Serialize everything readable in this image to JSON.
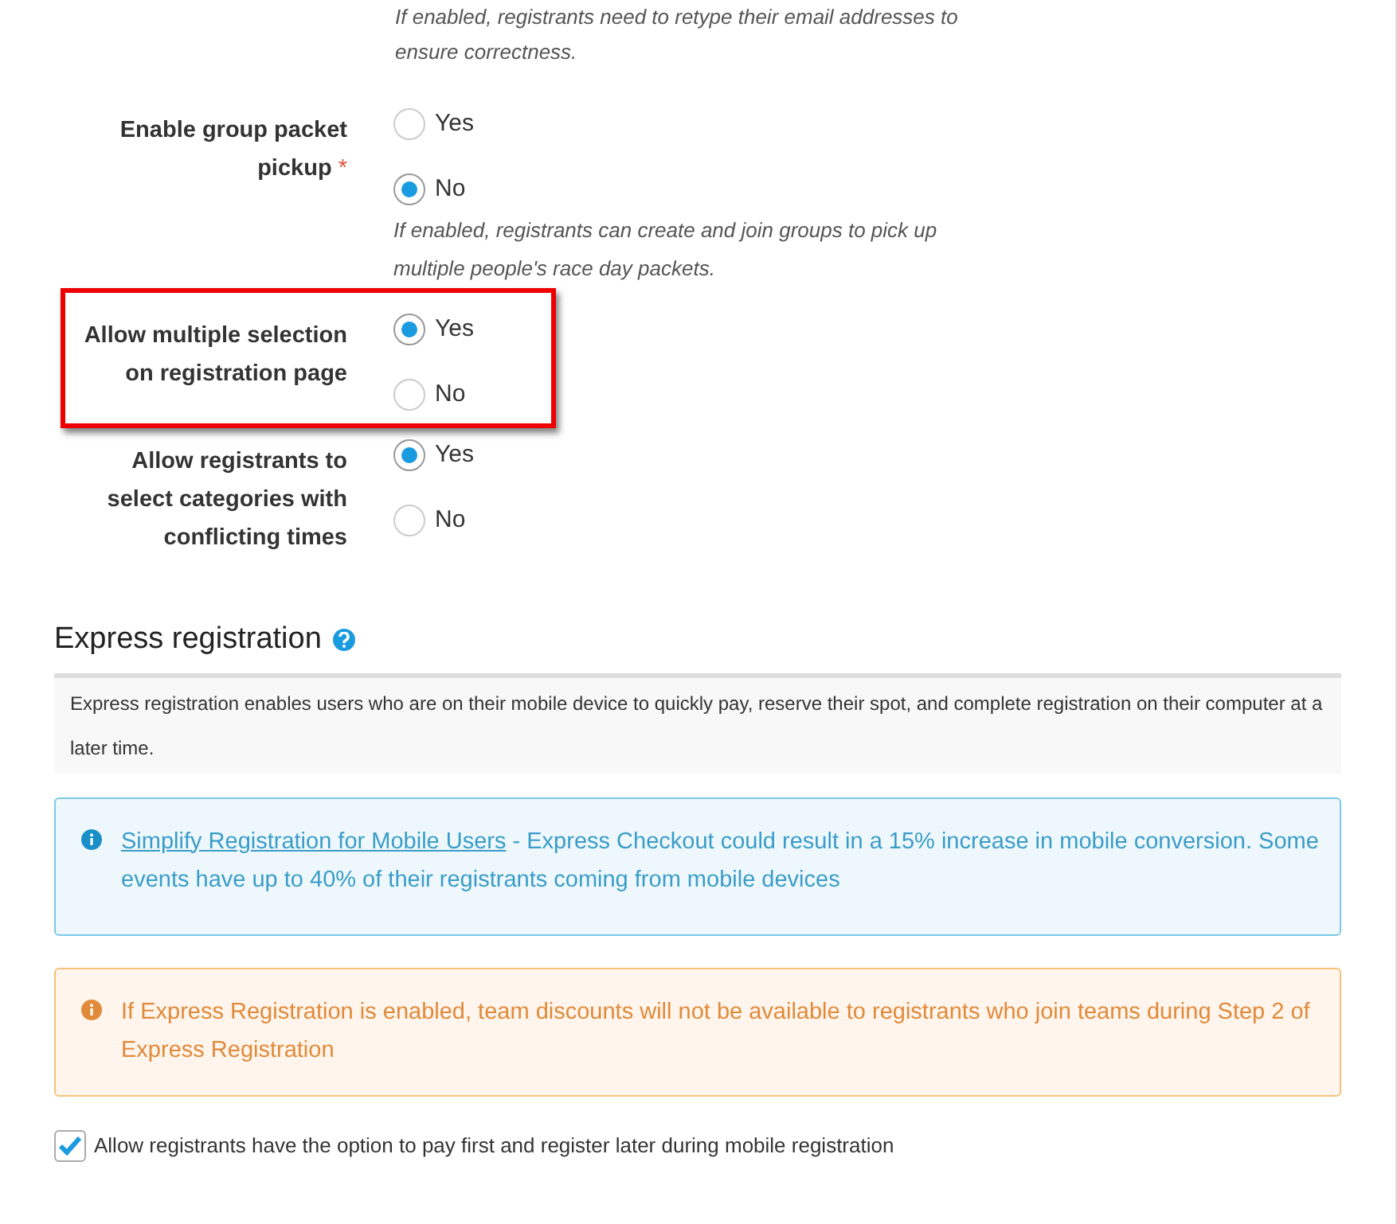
{
  "top_hint": {
    "lines": [
      "If enabled, registrants need to retype their email addresses to",
      "ensure correctness."
    ]
  },
  "settings": [
    {
      "label": "Enable group packet pickup",
      "required_mark": "*",
      "highlighted": false,
      "options": [
        {
          "label": "Yes",
          "selected": false
        },
        {
          "label": "No",
          "selected": true
        }
      ],
      "hint": "If enabled, registrants can create and join groups to pick up multiple people's race day packets."
    },
    {
      "label": "Allow multiple selection on registration page",
      "highlighted": true,
      "options": [
        {
          "label": "Yes",
          "selected": true
        },
        {
          "label": "No",
          "selected": false
        }
      ]
    },
    {
      "label": "Allow registrants to select categories with conflicting times",
      "highlighted": false,
      "options": [
        {
          "label": "Yes",
          "selected": true
        },
        {
          "label": "No",
          "selected": false
        }
      ]
    }
  ],
  "express": {
    "title": "Express registration",
    "description": "Express registration enables users who are on their mobile device to quickly pay, reserve their spot, and complete registration on their computer at a later time.",
    "alerts": [
      {
        "kind": "info",
        "link": "Simplify Registration for Mobile Users",
        "text": " - Express Checkout could result in a 15% increase in mobile conversion. Some events have up to 40% of their registrants coming from mobile devices"
      },
      {
        "kind": "warning",
        "text": "If Express Registration is enabled, team discounts will not be available to registrants who join teams during Step 2 of Express Registration"
      }
    ],
    "checkbox": {
      "label": "Allow registrants have the option to pay first and register later during mobile registration",
      "checked": true
    }
  }
}
